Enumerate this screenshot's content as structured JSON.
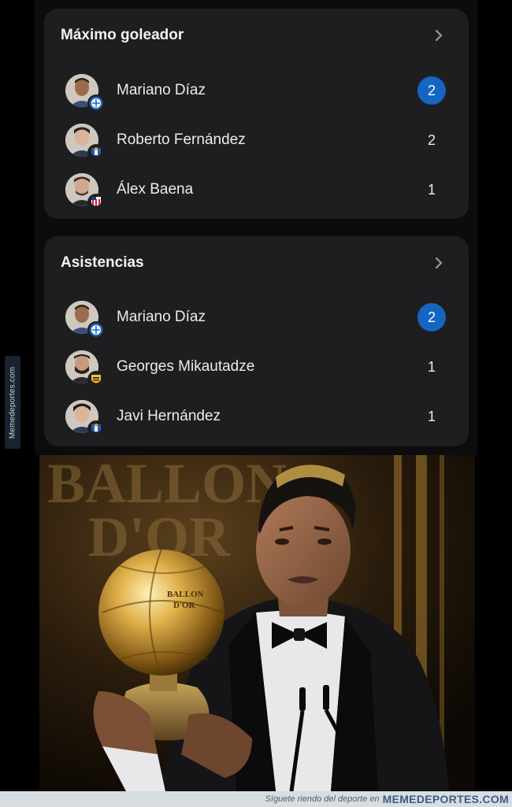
{
  "watermark": {
    "side_text": "Memedeportes.com"
  },
  "top_scorers": {
    "title": "Máximo goleador",
    "chevron_icon": "chevron-right-icon",
    "players": [
      {
        "name": "Mariano Díaz",
        "value": "2",
        "leader": true,
        "club_icon": "alaves-badge-icon",
        "club_color": "#1e64b7"
      },
      {
        "name": "Roberto Fernández",
        "value": "2",
        "leader": false,
        "club_icon": "espanyol-badge-icon",
        "club_color": "#1f5fb5"
      },
      {
        "name": "Álex Baena",
        "value": "1",
        "leader": false,
        "club_icon": "atletico-badge-icon",
        "club_color": "#c8202d"
      }
    ]
  },
  "assists": {
    "title": "Asistencias",
    "chevron_icon": "chevron-right-icon",
    "players": [
      {
        "name": "Mariano Díaz",
        "value": "2",
        "leader": true,
        "club_icon": "alaves-badge-icon",
        "club_color": "#1e64b7"
      },
      {
        "name": "Georges Mikautadze",
        "value": "1",
        "leader": false,
        "club_icon": "villarreal-badge-icon",
        "club_color": "#f2c514"
      },
      {
        "name": "Javi Hernández",
        "value": "1",
        "leader": false,
        "club_icon": "espanyol-badge-icon",
        "club_color": "#1f5fb5"
      }
    ]
  },
  "photo": {
    "description_icon": "ballon-dor-trophy-photo",
    "backdrop_text": [
      "BALLON",
      "D'OR"
    ],
    "trophy_text": [
      "BALLON",
      "D'OR"
    ]
  },
  "footer": {
    "tagline": "Síguete riendo del deporte en",
    "brand": "MEMEDEPORTES.COM"
  },
  "colors": {
    "card_bg": "#1e1e20",
    "leader_badge": "#1665c1",
    "footer_bg": "#d8dde2",
    "brand": "#3e5a84"
  }
}
